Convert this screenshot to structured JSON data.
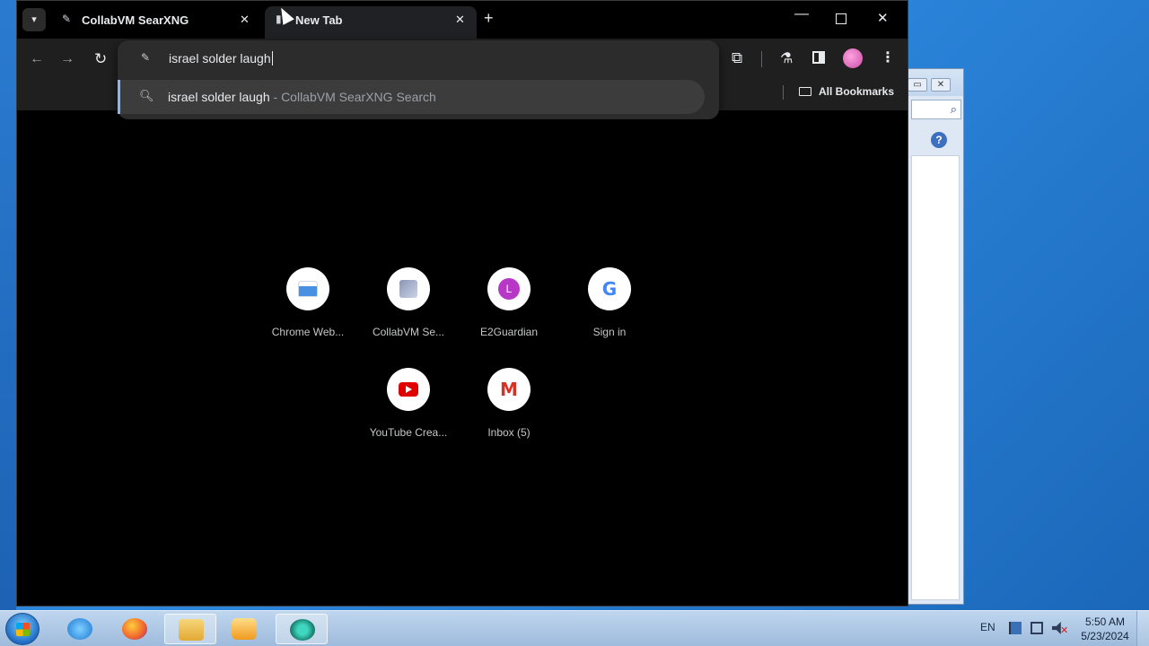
{
  "browser": {
    "tabs": [
      {
        "title": "CollabVM SearXNG",
        "favicon": "searxng-icon",
        "active": false
      },
      {
        "title": "New Tab",
        "favicon": "new-tab-icon",
        "active": true
      }
    ],
    "omnibox": {
      "text": "israel solder laugh",
      "suggestion_query": "israel solder laugh",
      "suggestion_source": " - CollabVM SearXNG Search"
    },
    "bookmarks": {
      "folder_label": "All Bookmarks"
    },
    "shortcuts": [
      {
        "label": "Chrome Web...",
        "icon": "chrome-web-store-icon"
      },
      {
        "label": "CollabVM Se...",
        "icon": "collabvm-icon"
      },
      {
        "label": "E2Guardian",
        "icon": "letter-l-icon",
        "letter": "L"
      },
      {
        "label": "Sign in",
        "icon": "google-icon",
        "letter": "G"
      },
      {
        "label": "YouTube Crea...",
        "icon": "youtube-icon"
      },
      {
        "label": "Inbox (5)",
        "icon": "gmail-icon",
        "letter": "M"
      }
    ]
  },
  "taskbar": {
    "language": "EN",
    "time": "5:50 AM",
    "date": "5/23/2024",
    "apps": [
      "internet-explorer-icon",
      "firefox-icon",
      "explorer-icon",
      "media-player-icon",
      "chrome-icon"
    ]
  },
  "background_window": {
    "help_glyph": "?"
  },
  "colors": {
    "browser_bg": "#000000",
    "toolbar": "#1f1f1f",
    "omnibox": "#2c2c2c",
    "suggestion_accent": "#8ab4f8",
    "desktop": "#1c6fc0"
  }
}
